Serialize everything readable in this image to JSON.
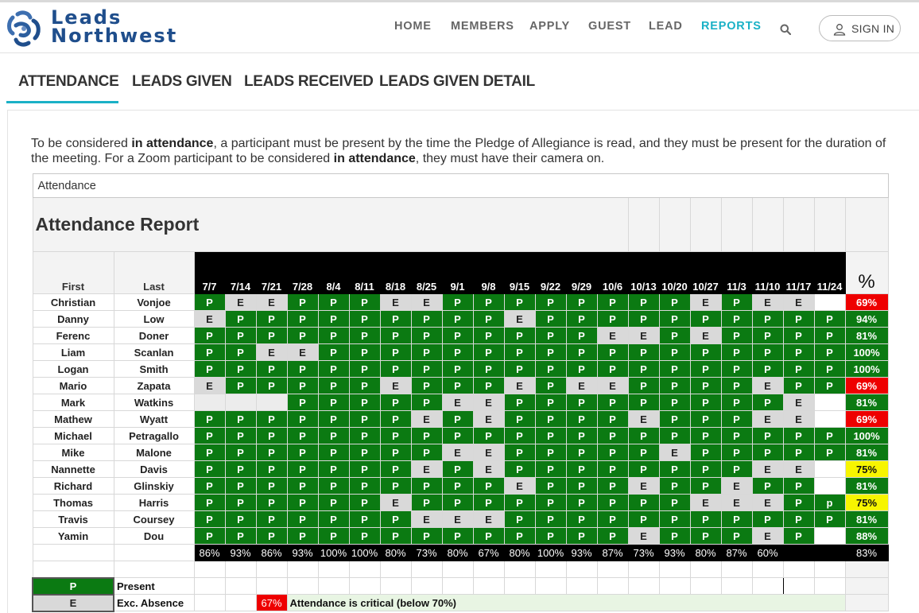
{
  "brand": {
    "line1": "Leads",
    "line2": "Northwest"
  },
  "nav": [
    {
      "label": "HOME",
      "name": "nav-home",
      "active": false
    },
    {
      "label": "MEMBERS",
      "name": "nav-members",
      "active": false
    },
    {
      "label": "APPLY",
      "name": "nav-apply",
      "active": false
    },
    {
      "label": "GUEST",
      "name": "nav-guest",
      "active": false
    },
    {
      "label": "LEAD",
      "name": "nav-lead",
      "active": false
    },
    {
      "label": "REPORTS",
      "name": "nav-reports",
      "active": true
    }
  ],
  "sign_in": "SIGN IN",
  "tabs": [
    {
      "label": "ATTENDANCE",
      "name": "tab-attendance",
      "active": true
    },
    {
      "label": "LEADS GIVEN",
      "name": "tab-leads-given",
      "active": false
    },
    {
      "label": "LEADS RECEIVED",
      "name": "tab-leads-received",
      "active": false
    },
    {
      "label": "LEADS GIVEN DETAIL",
      "name": "tab-leads-given-detail",
      "active": false
    }
  ],
  "intro": {
    "p1": "To be considered ",
    "b1": "in attendance",
    "p2": ", a participant must be present by the time the Pledge of Allegiance is read, and they must be present for the duration of the meeting. For a Zoom participant to be considered ",
    "b2": "in attendance",
    "p3": ", they must have their camera on."
  },
  "report": {
    "caption": "Attendance",
    "title": "Attendance Report",
    "col_first": "First",
    "col_last": "Last",
    "pct_header": "%",
    "dates": [
      "7/7",
      "7/14",
      "7/21",
      "7/28",
      "8/4",
      "8/11",
      "8/18",
      "8/25",
      "9/1",
      "9/8",
      "9/15",
      "9/22",
      "9/29",
      "10/6",
      "10/13",
      "10/20",
      "10/27",
      "11/3",
      "11/10",
      "11/17",
      "11/24"
    ],
    "rows": [
      {
        "first": "Christian",
        "last": "Vonjoe",
        "marks": [
          "P",
          "E",
          "E",
          "P",
          "P",
          "P",
          "E",
          "E",
          "P",
          "P",
          "P",
          "P",
          "P",
          "P",
          "P",
          "P",
          "E",
          "P",
          "E",
          "E",
          ""
        ],
        "pct": "69%",
        "level": "red"
      },
      {
        "first": "Danny",
        "last": "Low",
        "marks": [
          "E",
          "P",
          "P",
          "P",
          "P",
          "P",
          "P",
          "P",
          "P",
          "P",
          "E",
          "P",
          "P",
          "P",
          "P",
          "P",
          "P",
          "P",
          "P",
          "P",
          "P"
        ],
        "pct": "94%",
        "level": "green"
      },
      {
        "first": "Ferenc",
        "last": "Doner",
        "marks": [
          "P",
          "P",
          "P",
          "P",
          "P",
          "P",
          "P",
          "P",
          "P",
          "P",
          "P",
          "P",
          "P",
          "E",
          "E",
          "P",
          "E",
          "P",
          "P",
          "P",
          "P"
        ],
        "pct": "81%",
        "level": "green"
      },
      {
        "first": "Liam",
        "last": "Scanlan",
        "marks": [
          "P",
          "P",
          "E",
          "E",
          "P",
          "P",
          "P",
          "P",
          "P",
          "P",
          "P",
          "P",
          "P",
          "P",
          "P",
          "P",
          "P",
          "P",
          "P",
          "P",
          "P"
        ],
        "pct": "100%",
        "level": "green"
      },
      {
        "first": "Logan",
        "last": "Smith",
        "marks": [
          "P",
          "P",
          "P",
          "P",
          "P",
          "P",
          "P",
          "P",
          "P",
          "P",
          "P",
          "P",
          "P",
          "P",
          "P",
          "P",
          "P",
          "P",
          "P",
          "P",
          "P"
        ],
        "pct": "100%",
        "level": "green"
      },
      {
        "first": "Mario",
        "last": "Zapata",
        "marks": [
          "E",
          "P",
          "P",
          "P",
          "P",
          "P",
          "E",
          "P",
          "P",
          "P",
          "E",
          "P",
          "E",
          "E",
          "P",
          "P",
          "P",
          "P",
          "E",
          "P",
          "P"
        ],
        "pct": "69%",
        "level": "red"
      },
      {
        "first": "Mark",
        "last": "Watkins",
        "marks": [
          "",
          "",
          "",
          "P",
          "P",
          "P",
          "P",
          "P",
          "E",
          "E",
          "P",
          "P",
          "P",
          "P",
          "P",
          "P",
          "P",
          "P",
          "P",
          "E",
          ""
        ],
        "pct": "81%",
        "level": "green"
      },
      {
        "first": "Mathew",
        "last": "Wyatt",
        "marks": [
          "P",
          "P",
          "P",
          "P",
          "P",
          "P",
          "P",
          "E",
          "P",
          "E",
          "P",
          "P",
          "P",
          "P",
          "E",
          "P",
          "P",
          "P",
          "E",
          "E",
          ""
        ],
        "pct": "69%",
        "level": "red"
      },
      {
        "first": "Michael",
        "last": "Petragallo",
        "marks": [
          "P",
          "P",
          "P",
          "P",
          "P",
          "P",
          "P",
          "P",
          "P",
          "P",
          "P",
          "P",
          "P",
          "P",
          "P",
          "P",
          "P",
          "P",
          "P",
          "P",
          "P"
        ],
        "pct": "100%",
        "level": "green"
      },
      {
        "first": "Mike",
        "last": "Malone",
        "marks": [
          "P",
          "P",
          "P",
          "P",
          "P",
          "P",
          "P",
          "P",
          "E",
          "E",
          "P",
          "P",
          "P",
          "P",
          "P",
          "E",
          "P",
          "P",
          "P",
          "P",
          "P"
        ],
        "pct": "81%",
        "level": "green"
      },
      {
        "first": "Nannette",
        "last": "Davis",
        "marks": [
          "P",
          "P",
          "P",
          "P",
          "P",
          "P",
          "P",
          "E",
          "P",
          "E",
          "P",
          "P",
          "P",
          "P",
          "P",
          "P",
          "P",
          "P",
          "E",
          "E",
          ""
        ],
        "pct": "75%",
        "level": "yellow"
      },
      {
        "first": "Richard",
        "last": "Glinskiy",
        "marks": [
          "P",
          "P",
          "P",
          "P",
          "P",
          "P",
          "P",
          "P",
          "P",
          "P",
          "E",
          "P",
          "P",
          "P",
          "E",
          "P",
          "P",
          "E",
          "P",
          "P",
          ""
        ],
        "pct": "81%",
        "level": "green"
      },
      {
        "first": "Thomas",
        "last": "Harris",
        "marks": [
          "P",
          "P",
          "P",
          "P",
          "P",
          "P",
          "E",
          "P",
          "P",
          "P",
          "P",
          "P",
          "P",
          "P",
          "P",
          "P",
          "E",
          "E",
          "E",
          "P",
          "p"
        ],
        "pct": "75%",
        "level": "yellow"
      },
      {
        "first": "Travis",
        "last": "Coursey",
        "marks": [
          "P",
          "P",
          "P",
          "P",
          "P",
          "P",
          "P",
          "E",
          "E",
          "E",
          "P",
          "P",
          "P",
          "P",
          "P",
          "P",
          "P",
          "P",
          "P",
          "P",
          "P"
        ],
        "pct": "81%",
        "level": "green"
      },
      {
        "first": "Yamin",
        "last": "Dou",
        "marks": [
          "P",
          "P",
          "P",
          "P",
          "P",
          "P",
          "P",
          "P",
          "P",
          "P",
          "P",
          "P",
          "P",
          "P",
          "E",
          "P",
          "P",
          "P",
          "E",
          "P",
          ""
        ],
        "pct": "88%",
        "level": "green"
      }
    ],
    "totals": [
      "86%",
      "93%",
      "86%",
      "93%",
      "100%",
      "100%",
      "80%",
      "73%",
      "80%",
      "67%",
      "80%",
      "100%",
      "93%",
      "87%",
      "73%",
      "93%",
      "80%",
      "87%",
      "60%",
      "",
      ""
    ],
    "total_pct": "83%",
    "legend": {
      "present_code": "P",
      "present_label": "Present",
      "absence_code": "E",
      "absence_label": "Exc. Absence",
      "critical_pct": "67%",
      "critical_label": "Attendance is critical (below 70%)"
    }
  }
}
